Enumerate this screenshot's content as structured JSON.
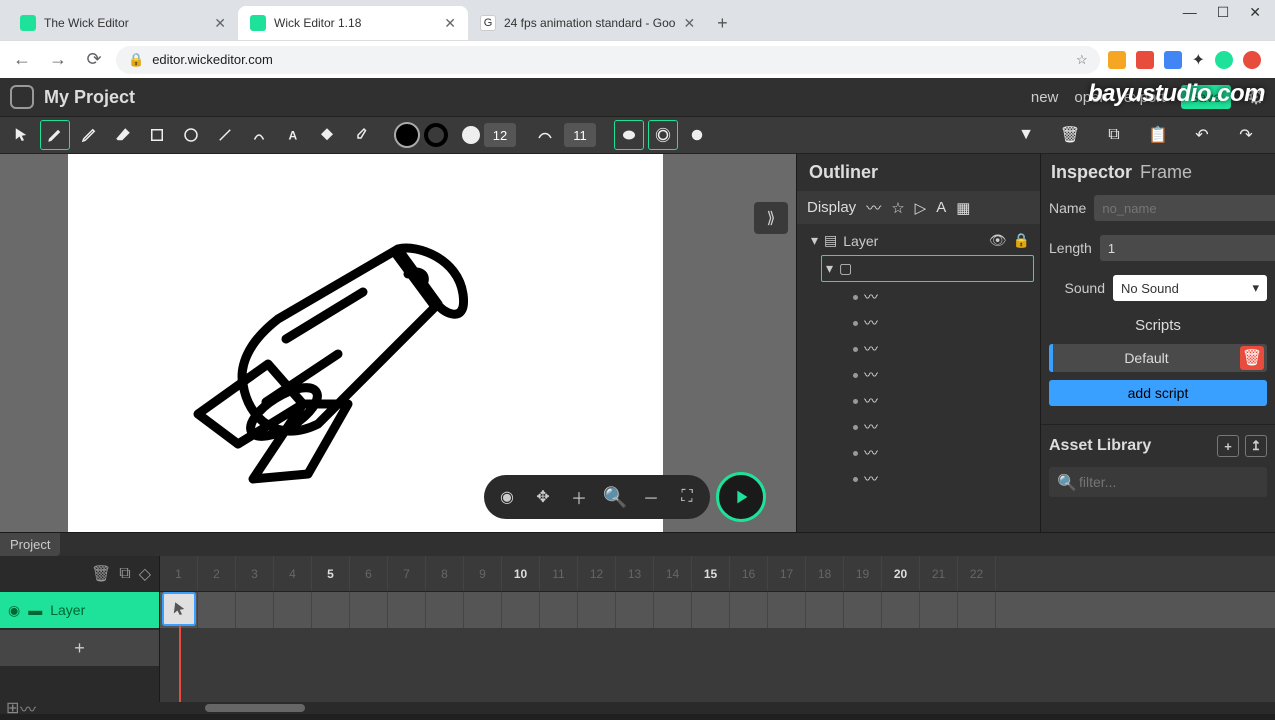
{
  "browser": {
    "tabs": [
      {
        "title": "The Wick Editor",
        "favicon_bg": "#1ee29a",
        "active": false
      },
      {
        "title": "Wick Editor 1.18",
        "favicon_bg": "#1ee29a",
        "active": true
      },
      {
        "title": "24 fps animation standard - Goo",
        "favicon_bg": "#fff",
        "active": false
      }
    ],
    "url": "editor.wickeditor.com"
  },
  "app": {
    "title": "My Project",
    "actions": {
      "new": "new",
      "open": "open",
      "export": "export",
      "save": "save"
    }
  },
  "toolbar": {
    "brush_size": "12",
    "smooth": "11"
  },
  "outliner": {
    "title": "Outliner",
    "display": "Display",
    "layer_name": "Layer",
    "path_count": 8
  },
  "inspector": {
    "title": "Inspector",
    "subtitle": "Frame",
    "name_label": "Name",
    "name_placeholder": "no_name",
    "length_label": "Length",
    "length_value": "1",
    "sound_label": "Sound",
    "sound_value": "No Sound",
    "scripts_header": "Scripts",
    "default_script": "Default",
    "add_script": "add script"
  },
  "asset_library": {
    "title": "Asset Library",
    "filter_placeholder": "filter..."
  },
  "timeline": {
    "tab": "Project",
    "layer_name": "Layer",
    "ticks": [
      1,
      2,
      3,
      4,
      5,
      6,
      7,
      8,
      9,
      10,
      11,
      12,
      13,
      14,
      15,
      16,
      17,
      18,
      19,
      20,
      21,
      22
    ],
    "majors": [
      5,
      10,
      15,
      20
    ]
  },
  "watermark": "bayustudio.com"
}
